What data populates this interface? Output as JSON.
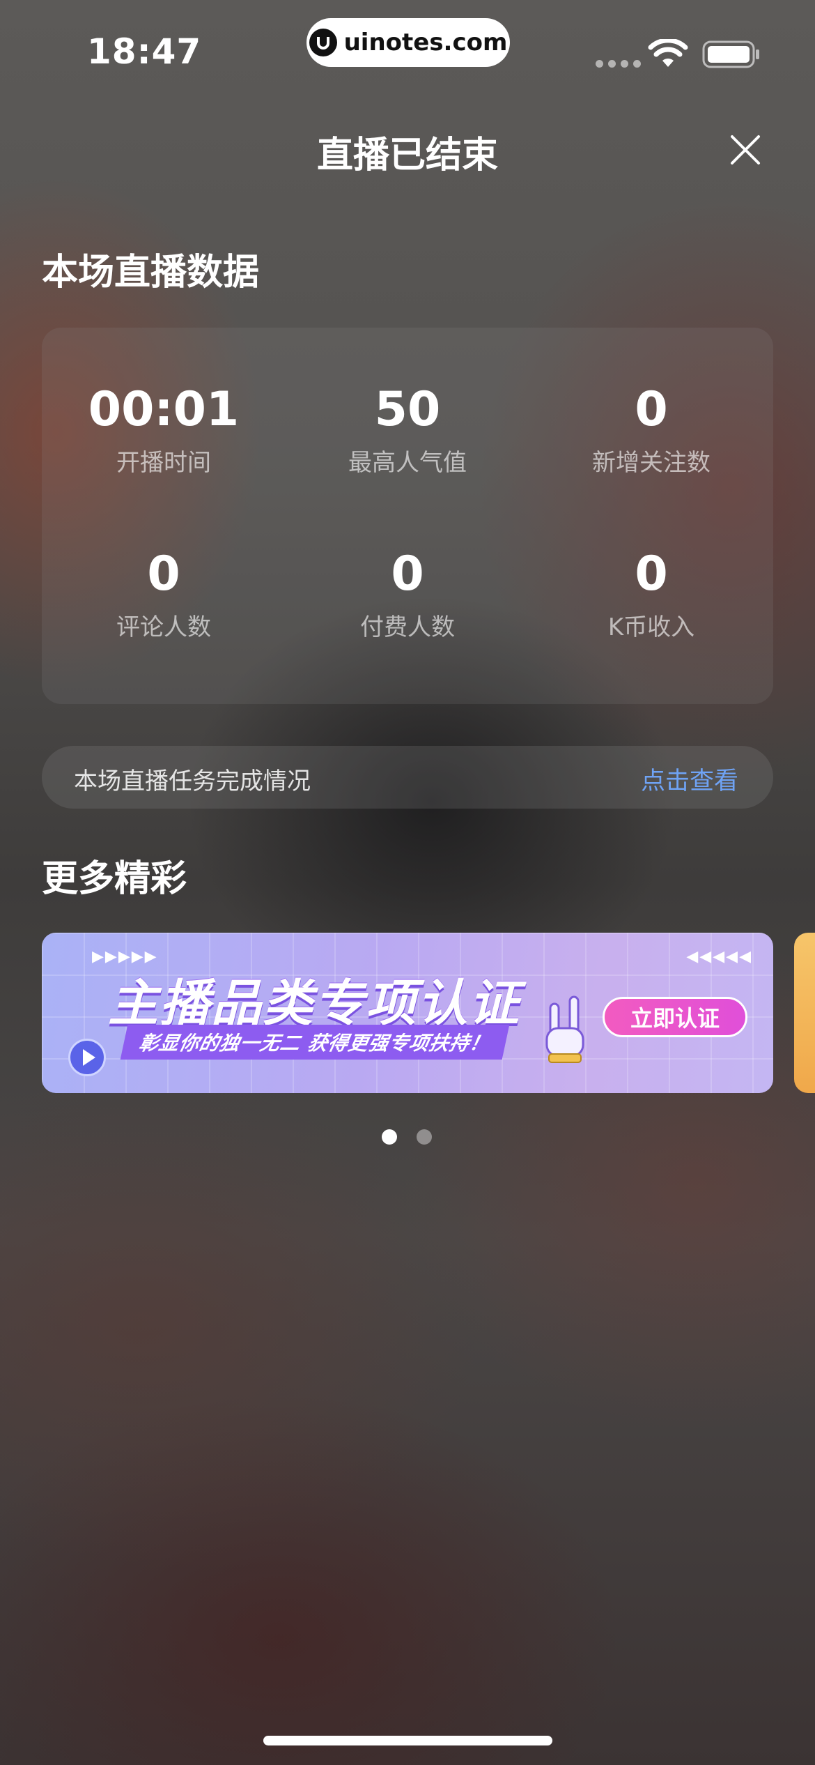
{
  "status_bar": {
    "time": "18:47",
    "url": "uinotes.com",
    "icons": [
      "signal-icon",
      "wifi-icon",
      "battery-icon"
    ]
  },
  "header": {
    "title": "直播已结束",
    "close_icon": "close-icon"
  },
  "stats_section": {
    "title": "本场直播数据",
    "items": [
      {
        "value": "00:01",
        "label": "开播时间"
      },
      {
        "value": "50",
        "label": "最高人气值"
      },
      {
        "value": "0",
        "label": "新增关注数"
      },
      {
        "value": "0",
        "label": "评论人数"
      },
      {
        "value": "0",
        "label": "付费人数"
      },
      {
        "value": "0",
        "label": "K币收入"
      }
    ]
  },
  "task_row": {
    "label": "本场直播任务完成情况",
    "link": "点击查看",
    "link_color": "#6fa3f5"
  },
  "more_section": {
    "title": "更多精彩",
    "banner": {
      "headline": "主播品类专项认证",
      "subline": "彰显你的独一无二 获得更强专项扶持！",
      "cta": "立即认证"
    },
    "pagination": {
      "count": 2,
      "active": 1
    }
  }
}
